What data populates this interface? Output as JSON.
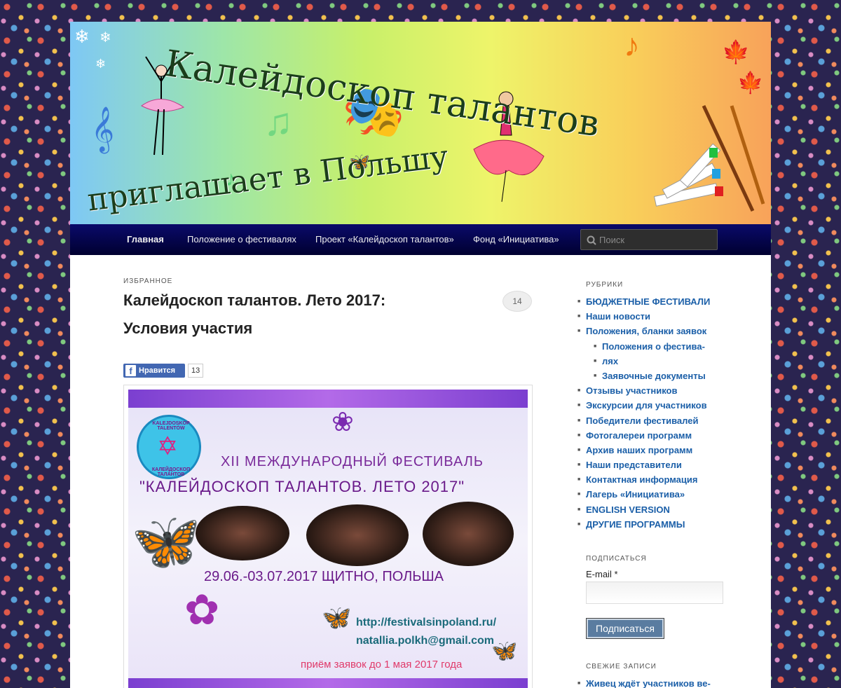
{
  "banner": {
    "title": "Калейдоскоп талантов",
    "subtitle": "приглашает в Польшу"
  },
  "nav": {
    "items": [
      {
        "label": "Главная"
      },
      {
        "label": "Положение о фестивалях"
      },
      {
        "label": "Проект «Калейдоскоп талантов»"
      },
      {
        "label": "Фонд «Инициатива»"
      }
    ],
    "search_placeholder": "Поиск"
  },
  "post": {
    "kicker": "ИЗБРАННОЕ",
    "title": "Калейдоскоп талантов. Лето 2017: Условия участия",
    "comment_count": "14",
    "fb_like_label": "Нравится",
    "fb_like_count": "13",
    "poster": {
      "badge_top": "KALEJDOSKOP TALENTÓW",
      "badge_bottom": "КАЛЕЙДОСКОП ТАЛАНТОВ",
      "line1": "XII МЕЖДУНАРОДНЫЙ ФЕСТИВАЛЬ",
      "line2": "\"КАЛЕЙДОСКОП ТАЛАНТОВ. ЛЕТО 2017\"",
      "dates": "29.06.-03.07.2017 ЩИТНО, ПОЛЬША",
      "url": "http://festivalsinpoland.ru/",
      "email": "natallia.polkh@gmail.com",
      "deadline": "приём заявок до 1 мая 2017 года"
    }
  },
  "sidebar": {
    "categories_title": "РУБРИКИ",
    "categories": [
      {
        "label": "БЮДЖЕТНЫЕ ФЕСТИВАЛИ"
      },
      {
        "label": "Наши новости"
      },
      {
        "label": "Положения, бланки заявок"
      },
      {
        "label": "Положения о фестива-"
      },
      {
        "label": "лях"
      },
      {
        "label": "Заявочные документы"
      },
      {
        "label": "Отзывы участников"
      },
      {
        "label": "Экскурсии для участников"
      },
      {
        "label": "Победители фестивалей"
      },
      {
        "label": "Фотогалереи программ"
      },
      {
        "label": "Архив наших программ"
      },
      {
        "label": "Наши представители"
      },
      {
        "label": "Контактная информация"
      },
      {
        "label": "Лагерь «Инициатива»"
      },
      {
        "label": "ENGLISH VERSION"
      },
      {
        "label": "ДРУГИЕ ПРОГРАММЫ"
      }
    ],
    "subscribe_title": "ПОДПИСАТЬСЯ",
    "email_label": "E-mail *",
    "subscribe_button": "Подписаться",
    "recent_title": "СВЕЖИЕ ЗАПИСИ",
    "recent": [
      {
        "label": "Живец ждёт участников ве-"
      }
    ]
  },
  "colors": {
    "nav_bg": "#00004a",
    "link": "#1b5fa8",
    "button": "#5a7ca0"
  }
}
